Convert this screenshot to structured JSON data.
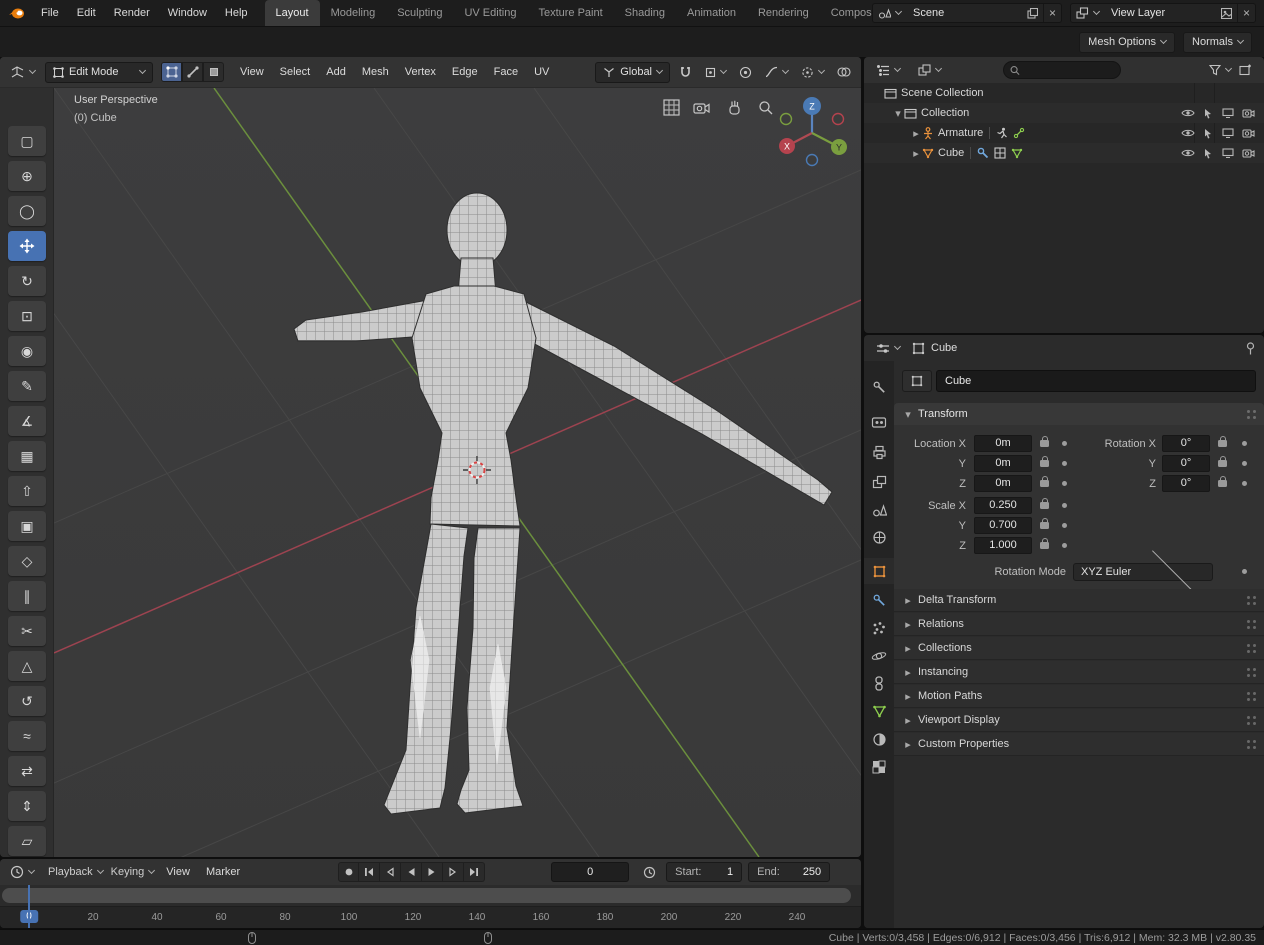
{
  "topbar": {
    "menus": [
      "File",
      "Edit",
      "Render",
      "Window",
      "Help"
    ],
    "tabs": [
      "Layout",
      "Modeling",
      "Sculpting",
      "UV Editing",
      "Texture Paint",
      "Shading",
      "Animation",
      "Rendering",
      "Compositi"
    ],
    "scene_label": "Scene",
    "view_layer_label": "View Layer"
  },
  "tool_settings": {
    "mesh_options": "Mesh Options",
    "normals": "Normals"
  },
  "viewport_header": {
    "mode": "Edit Mode",
    "menus": [
      "View",
      "Select",
      "Add",
      "Mesh",
      "Vertex",
      "Edge",
      "Face",
      "UV"
    ],
    "orientation": "Global"
  },
  "viewport": {
    "perspective_label": "User Perspective",
    "object_label": "(0) Cube",
    "gizmo": {
      "x": "X",
      "y": "Y",
      "z": "Z"
    }
  },
  "toolbar": {
    "tools": [
      {
        "name": "select-box",
        "glyph": "▢"
      },
      {
        "name": "cursor",
        "glyph": "⊕"
      },
      {
        "name": "select-circle",
        "glyph": "◯"
      },
      {
        "name": "move",
        "glyph": ""
      },
      {
        "name": "rotate",
        "glyph": "↻"
      },
      {
        "name": "scale",
        "glyph": "⊡"
      },
      {
        "name": "transform",
        "glyph": "◉"
      },
      {
        "name": "annotate",
        "glyph": "✎"
      },
      {
        "name": "measure",
        "glyph": "∡"
      },
      {
        "name": "add-cube",
        "glyph": "▦"
      },
      {
        "name": "extrude-region",
        "glyph": "⇧"
      },
      {
        "name": "inset-faces",
        "glyph": "▣"
      },
      {
        "name": "bevel",
        "glyph": "◇"
      },
      {
        "name": "loop-cut",
        "glyph": "∥"
      },
      {
        "name": "knife",
        "glyph": "✂"
      },
      {
        "name": "poly-build",
        "glyph": "△"
      },
      {
        "name": "spin",
        "glyph": "↺"
      },
      {
        "name": "smooth",
        "glyph": "≈"
      },
      {
        "name": "edge-slide",
        "glyph": "⇄"
      },
      {
        "name": "shrink-fatten",
        "glyph": "⇕"
      },
      {
        "name": "shear",
        "glyph": "▱"
      }
    ]
  },
  "outliner": {
    "rows": [
      {
        "label": "Scene Collection"
      },
      {
        "label": "Collection"
      },
      {
        "label": "Armature"
      },
      {
        "label": "Cube"
      }
    ]
  },
  "properties": {
    "breadcrumb": "Cube",
    "name_value": "Cube",
    "tabs": [
      "tool",
      "render",
      "output",
      "view-layer",
      "scene",
      "world",
      "object",
      "modifiers",
      "particles",
      "physics",
      "constraints",
      "object-data",
      "material",
      "texture"
    ],
    "active_tab": "object",
    "transform": {
      "header": "Transform",
      "loc_labels": [
        "Location X",
        "Y",
        "Z"
      ],
      "loc_values": [
        "0m",
        "0m",
        "0m"
      ],
      "rot_labels": [
        "Rotation X",
        "Y",
        "Z"
      ],
      "rot_values": [
        "0°",
        "0°",
        "0°"
      ],
      "scale_labels": [
        "Scale X",
        "Y",
        "Z"
      ],
      "scale_values": [
        "0.250",
        "0.700",
        "1.000"
      ],
      "rotation_mode_label": "Rotation Mode",
      "rotation_mode_value": "XYZ Euler"
    },
    "sections": [
      "Delta Transform",
      "Relations",
      "Collections",
      "Instancing",
      "Motion Paths",
      "Viewport Display",
      "Custom Properties"
    ]
  },
  "timeline": {
    "playback_label": "Playback",
    "keying_label": "Keying",
    "menus": [
      "View",
      "Marker"
    ],
    "current_frame": "0",
    "start_label": "Start:",
    "start_value": "1",
    "end_label": "End:",
    "end_value": "250",
    "ticks": [
      "0",
      "20",
      "40",
      "60",
      "80",
      "100",
      "120",
      "140",
      "160",
      "180",
      "200",
      "220",
      "240"
    ],
    "playhead_frame": "0"
  },
  "status_bar": {
    "stats": "Cube | Verts:0/3,458 | Edges:0/6,912 | Faces:0/3,456 | Tris:6,912 | Mem: 32.3 MB | v2.80.35"
  },
  "glyphs": {
    "tri_right": "▸",
    "tri_down": "▾",
    "close": "×"
  },
  "colors": {
    "accent_blue": "#4772b3",
    "axis_x": "#c24e5c",
    "axis_y": "#7a9e3f",
    "axis_z": "#3f6fae",
    "object_orange": "#e8913c",
    "mesh_green": "#8ecf4e",
    "modifier_blue": "#71a8dd"
  }
}
